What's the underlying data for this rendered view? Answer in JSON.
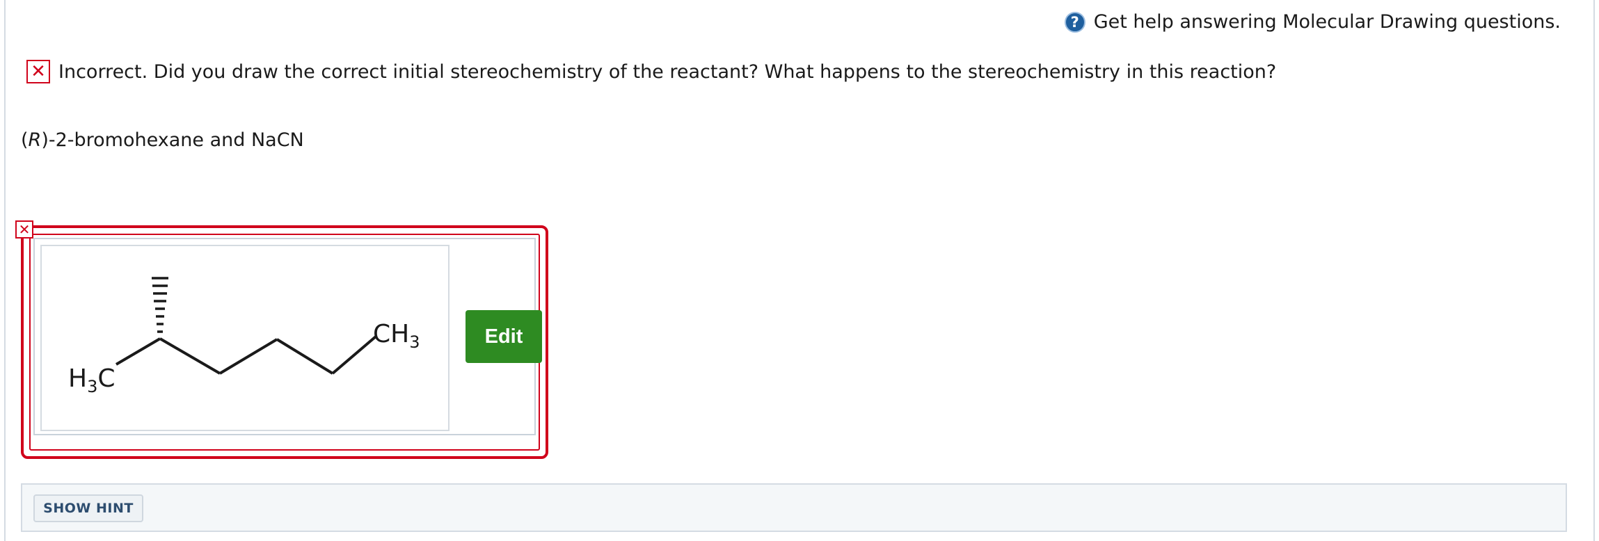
{
  "help": {
    "icon": "help-circle-icon",
    "icon_glyph": "?",
    "label": "Get help answering Molecular Drawing questions."
  },
  "feedback": {
    "icon": "incorrect-x-icon",
    "icon_glyph": "✕",
    "text": "Incorrect. Did you draw the correct initial stereochemistry of the reactant? What happens to the stereochemistry in this reaction?"
  },
  "question": {
    "prefix": "(",
    "stereo": "R",
    "rest": ")-2-bromohexane and NaCN"
  },
  "answer": {
    "status_icon": "incorrect-x-icon",
    "status_glyph": "✕",
    "status_color": "#d0021b",
    "molecule": {
      "left_group": "H",
      "left_sub": "3",
      "left_atom": "C",
      "right_group": "CH",
      "right_sub": "3"
    },
    "edit_label": "Edit",
    "edit_color": "#2e8b22"
  },
  "hint": {
    "label": "SHOW HINT"
  }
}
